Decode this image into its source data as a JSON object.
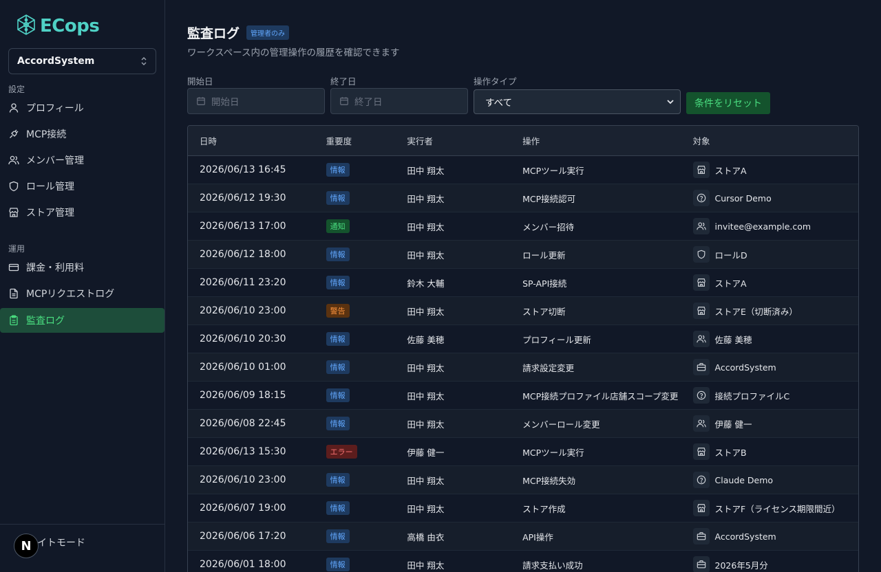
{
  "app": {
    "logo_text": "ECops"
  },
  "workspace": {
    "name": "AccordSystem"
  },
  "sidebar": {
    "settings_label": "設定",
    "settings_items": [
      {
        "label": "プロフィール",
        "icon": "user-icon"
      },
      {
        "label": "MCP接続",
        "icon": "plug-icon"
      },
      {
        "label": "メンバー管理",
        "icon": "users-icon"
      },
      {
        "label": "ロール管理",
        "icon": "shield-icon"
      },
      {
        "label": "ストア管理",
        "icon": "store-icon"
      }
    ],
    "ops_label": "運用",
    "ops_items": [
      {
        "label": "課金・利用料",
        "icon": "credit-card-icon"
      },
      {
        "label": "MCPリクエストログ",
        "icon": "file-text-icon"
      },
      {
        "label": "監査ログ",
        "icon": "clipboard-icon",
        "active": true
      }
    ],
    "theme_toggle": "ライトモード",
    "badge": "N"
  },
  "page": {
    "title": "監査ログ",
    "badge": "管理者のみ",
    "subtitle": "ワークスペース内の管理操作の履歴を確認できます"
  },
  "filters": {
    "start_label": "開始日",
    "start_placeholder": "開始日",
    "end_label": "終了日",
    "end_placeholder": "終了日",
    "type_label": "操作タイプ",
    "type_value": "すべて",
    "reset_label": "条件をリセット"
  },
  "table": {
    "headers": [
      "日時",
      "重要度",
      "実行者",
      "操作",
      "対象"
    ],
    "rows": [
      {
        "datetime": "2026/06/13 16:45",
        "severity": "情報",
        "level": "info",
        "actor": "田中 翔太",
        "action": "MCPツール実行",
        "target": "ストアA",
        "target_icon": "store-icon"
      },
      {
        "datetime": "2026/06/12 19:30",
        "severity": "情報",
        "level": "info",
        "actor": "田中 翔太",
        "action": "MCP接続認可",
        "target": "Cursor Demo",
        "target_icon": "help-circle-icon"
      },
      {
        "datetime": "2026/06/13 17:00",
        "severity": "通知",
        "level": "notice",
        "actor": "田中 翔太",
        "action": "メンバー招待",
        "target": "invitee@example.com",
        "target_icon": "users-icon"
      },
      {
        "datetime": "2026/06/12 18:00",
        "severity": "情報",
        "level": "info",
        "actor": "田中 翔太",
        "action": "ロール更新",
        "target": "ロールD",
        "target_icon": "shield-icon"
      },
      {
        "datetime": "2026/06/11 23:20",
        "severity": "情報",
        "level": "info",
        "actor": "鈴木 大輔",
        "action": "SP-API接続",
        "target": "ストアA",
        "target_icon": "store-icon"
      },
      {
        "datetime": "2026/06/10 23:00",
        "severity": "警告",
        "level": "warn",
        "actor": "田中 翔太",
        "action": "ストア切断",
        "target": "ストアE（切断済み）",
        "target_icon": "store-icon"
      },
      {
        "datetime": "2026/06/10 20:30",
        "severity": "情報",
        "level": "info",
        "actor": "佐藤 美穂",
        "action": "プロフィール更新",
        "target": "佐藤 美穂",
        "target_icon": "users-icon"
      },
      {
        "datetime": "2026/06/10 01:00",
        "severity": "情報",
        "level": "info",
        "actor": "田中 翔太",
        "action": "請求設定変更",
        "target": "AccordSystem",
        "target_icon": "briefcase-icon"
      },
      {
        "datetime": "2026/06/09 18:15",
        "severity": "情報",
        "level": "info",
        "actor": "田中 翔太",
        "action": "MCP接続プロファイル店舗スコープ変更",
        "target": "接続プロファイルC",
        "target_icon": "help-circle-icon"
      },
      {
        "datetime": "2026/06/08 22:45",
        "severity": "情報",
        "level": "info",
        "actor": "田中 翔太",
        "action": "メンバーロール変更",
        "target": "伊藤 健一",
        "target_icon": "users-icon"
      },
      {
        "datetime": "2026/06/13 15:30",
        "severity": "エラー",
        "level": "error",
        "actor": "伊藤 健一",
        "action": "MCPツール実行",
        "target": "ストアB",
        "target_icon": "store-icon"
      },
      {
        "datetime": "2026/06/10 23:00",
        "severity": "情報",
        "level": "info",
        "actor": "田中 翔太",
        "action": "MCP接続失効",
        "target": "Claude Demo",
        "target_icon": "help-circle-icon"
      },
      {
        "datetime": "2026/06/07 19:00",
        "severity": "情報",
        "level": "info",
        "actor": "田中 翔太",
        "action": "ストア作成",
        "target": "ストアF（ライセンス期限間近）",
        "target_icon": "store-icon"
      },
      {
        "datetime": "2026/06/06 17:20",
        "severity": "情報",
        "level": "info",
        "actor": "高橋 由衣",
        "action": "API操作",
        "target": "AccordSystem",
        "target_icon": "briefcase-icon"
      },
      {
        "datetime": "2026/06/01 18:00",
        "severity": "情報",
        "level": "info",
        "actor": "田中 翔太",
        "action": "請求支払い成功",
        "target": "2026年5月分",
        "target_icon": "briefcase-icon"
      }
    ]
  },
  "colors": {
    "accent": "#4ade80",
    "logo": "#4fd1c5",
    "info": "#60a5fa",
    "warn": "#fb923c",
    "error": "#f87171"
  }
}
